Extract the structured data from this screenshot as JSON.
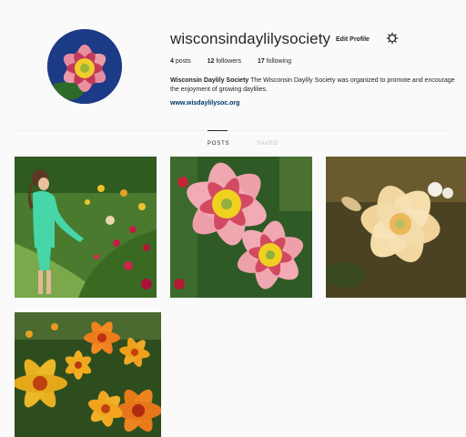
{
  "profile": {
    "username": "wisconsindaylilysociety",
    "edit_profile_label": "Edit Profile",
    "posts_count": "4",
    "posts_label": "posts",
    "followers_count": "12",
    "followers_label": "followers",
    "following_count": "17",
    "following_label": "following",
    "bio_name": "Wisconsin Daylily Society",
    "bio_text": "The Wisconsin Daylily Society was organized to promote and encourage the enjoyment of growing daylilies.",
    "website": "www.wisdaylilysoc.org"
  },
  "tabs": {
    "posts_label": "POSTS",
    "saved_label": "SAVED",
    "active": "posts"
  },
  "posts": [
    {
      "subject": "girl in green walking through daylily garden"
    },
    {
      "subject": "pink daylilies with yellow throats"
    },
    {
      "subject": "cream ruffled daylily"
    },
    {
      "subject": "orange and yellow daylily bed"
    }
  ],
  "icons": [
    "gear-icon"
  ],
  "colors": {
    "background": "#fafafa",
    "text": "#262626",
    "link": "#003569",
    "muted": "#bdbdbd"
  }
}
